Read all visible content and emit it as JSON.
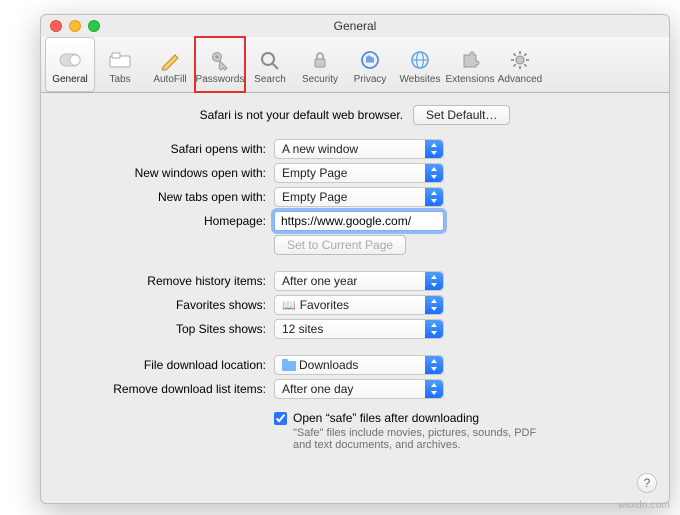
{
  "window": {
    "title": "General"
  },
  "toolbar": {
    "items": [
      {
        "name": "general",
        "label": "General"
      },
      {
        "name": "tabs",
        "label": "Tabs"
      },
      {
        "name": "autofill",
        "label": "AutoFill"
      },
      {
        "name": "passwords",
        "label": "Passwords"
      },
      {
        "name": "search",
        "label": "Search"
      },
      {
        "name": "security",
        "label": "Security"
      },
      {
        "name": "privacy",
        "label": "Privacy"
      },
      {
        "name": "websites",
        "label": "Websites"
      },
      {
        "name": "extensions",
        "label": "Extensions"
      },
      {
        "name": "advanced",
        "label": "Advanced"
      }
    ]
  },
  "default_browser": {
    "message": "Safari is not your default web browser.",
    "button": "Set Default…"
  },
  "labels": {
    "opens_with": "Safari opens with:",
    "new_windows": "New windows open with:",
    "new_tabs": "New tabs open with:",
    "homepage": "Homepage:",
    "set_current": "Set to Current Page",
    "remove_history": "Remove history items:",
    "favorites_shows": "Favorites shows:",
    "top_sites_shows": "Top Sites shows:",
    "download_location": "File download location:",
    "remove_downloads": "Remove download list items:",
    "open_safe": "Open “safe” files after downloading",
    "safe_note": "\"Safe\" files include movies, pictures, sounds, PDF and text documents, and archives."
  },
  "values": {
    "opens_with": "A new window",
    "new_windows": "Empty Page",
    "new_tabs": "Empty Page",
    "homepage": "https://www.google.com/",
    "remove_history": "After one year",
    "favorites_shows": "Favorites",
    "top_sites_shows": "12 sites",
    "download_location": "Downloads",
    "remove_downloads": "After one day",
    "open_safe_checked": true
  },
  "watermark": "wsxdn.com"
}
